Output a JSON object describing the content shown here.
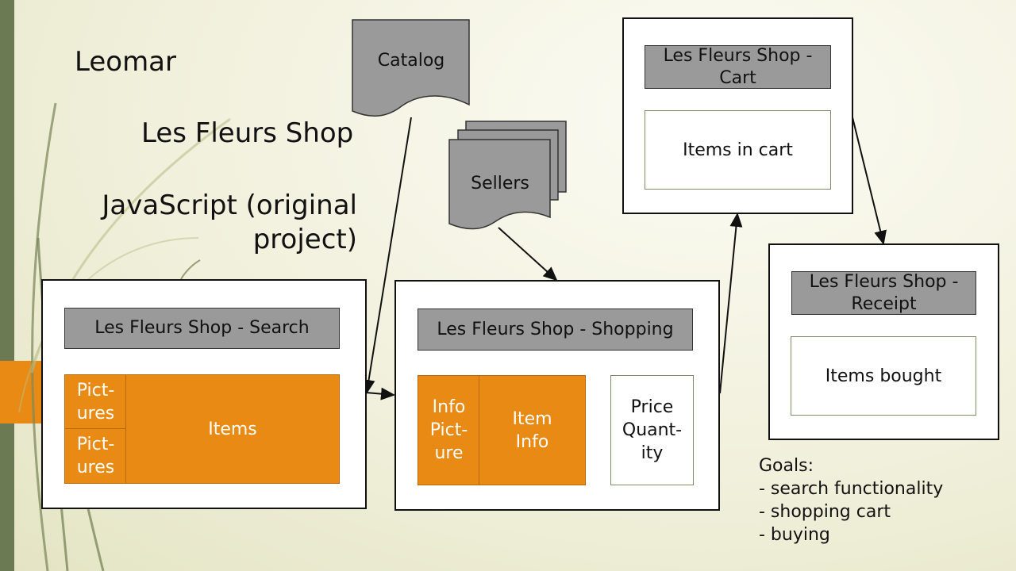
{
  "left_text": {
    "author": "Leomar",
    "shop": "Les Fleurs Shop",
    "tech": "JavaScript (original\nproject)"
  },
  "docs": {
    "catalog": "Catalog",
    "sellers": "Sellers"
  },
  "search_screen": {
    "header": "Les Fleurs Shop - Search",
    "pictures_1": "Pict-\nures",
    "pictures_2": "Pict-\nures",
    "items": "Items"
  },
  "shopping_screen": {
    "header": "Les Fleurs Shop - Shopping",
    "info_picture": "Info\nPict-\nure",
    "item_info": "Item\nInfo",
    "price_quantity": "Price\nQuant-\nity"
  },
  "cart_screen": {
    "header": "Les Fleurs Shop -\nCart",
    "items": "Items in cart"
  },
  "receipt_screen": {
    "header": "Les Fleurs Shop -\nReceipt",
    "items": "Items bought"
  },
  "goals": {
    "title": "Goals:",
    "items": [
      "- search functionality",
      "- shopping cart",
      "- buying"
    ]
  },
  "colors": {
    "orange": "#e88a13",
    "gray": "#9a9a9a",
    "sidebar_green": "#6b7a52"
  }
}
